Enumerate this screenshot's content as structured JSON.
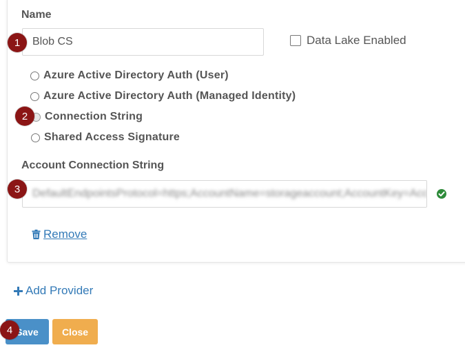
{
  "form": {
    "name_label": "Name",
    "name_value": "Blob CS",
    "data_lake_label": "Data Lake Enabled",
    "auth_options": [
      {
        "label": "Azure Active Directory Auth (User)",
        "checked": false
      },
      {
        "label": "Azure Active Directory Auth (Managed Identity)",
        "checked": false
      },
      {
        "label": "Connection String",
        "checked": true
      },
      {
        "label": "Shared Access Signature",
        "checked": false
      }
    ],
    "connection_string_label": "Account Connection String",
    "connection_string_value": "DefaultEndpointsProtocol=https;AccountName=storageaccount;AccountKey=Acce",
    "remove_label": "Remove"
  },
  "actions": {
    "add_provider_label": "Add Provider",
    "save_label": "Save",
    "close_label": "Close"
  },
  "annotations": [
    "1",
    "2",
    "3",
    "4"
  ],
  "colors": {
    "primary": "#4a90c8",
    "warning": "#f0ad4e",
    "link": "#337ab7",
    "success": "#2e8b3a",
    "badge": "#8b1515"
  }
}
